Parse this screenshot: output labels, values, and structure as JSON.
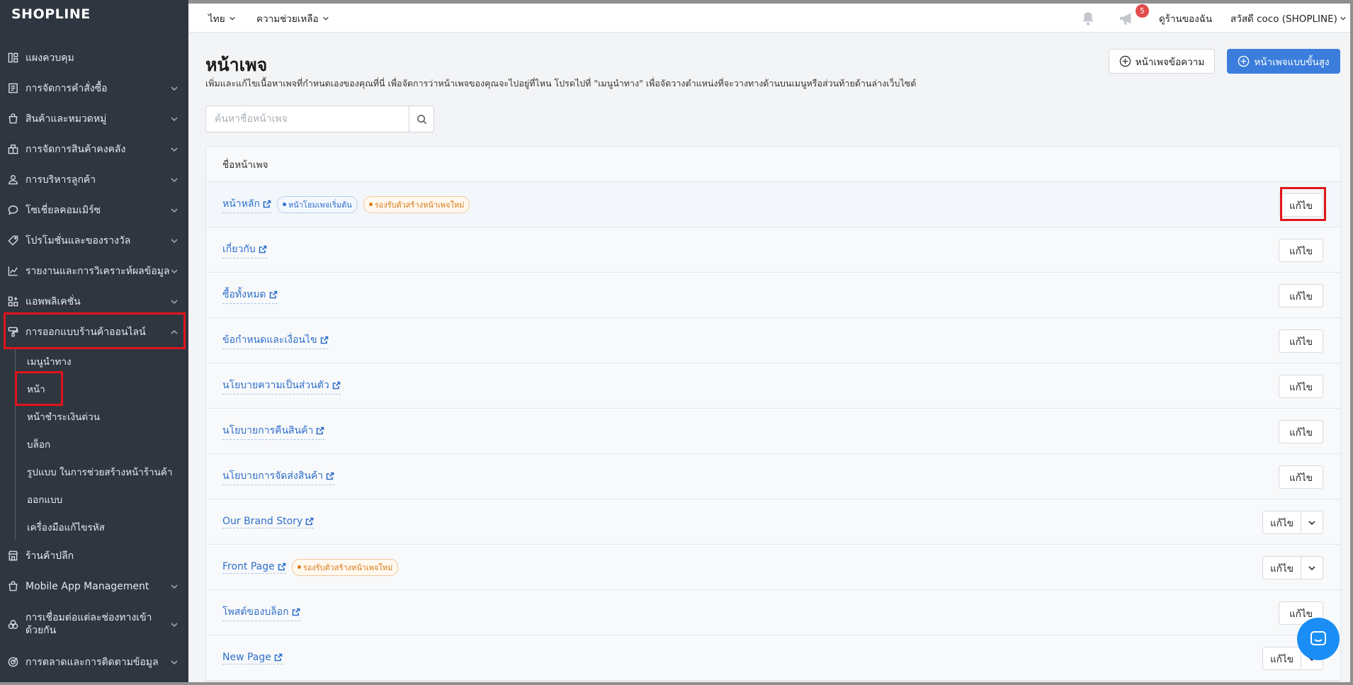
{
  "brand": {
    "logo": "SHOPLINE"
  },
  "topbar": {
    "language": "ไทย",
    "help": "ความช่วยเหลือ",
    "notification_count": "5",
    "view_store": "ดูร้านของฉัน",
    "greeting": "สวัสดี coco (SHOPLINE)"
  },
  "sidebar": {
    "items": [
      {
        "label": "แผงควบคุม",
        "icon": "dashboard-icon"
      },
      {
        "label": "การจัดการคำสั่งซื้อ",
        "icon": "order-icon"
      },
      {
        "label": "สินค้าและหมวดหมู่",
        "icon": "shopping-bag-icon"
      },
      {
        "label": "การจัดการสินค้าคงคลัง",
        "icon": "warehouse-icon"
      },
      {
        "label": "การบริหารลูกค้า",
        "icon": "user-icon"
      },
      {
        "label": "โซเชี่ยลคอมเมิร์ซ",
        "icon": "chat-icon"
      },
      {
        "label": "โปรโมชั่นและของรางวัล",
        "icon": "tag-icon"
      },
      {
        "label": "รายงานและการวิเคราะห์ผลข้อมูล",
        "icon": "chart-icon"
      },
      {
        "label": "แอพพลิเคชั่น",
        "icon": "apps-icon"
      },
      {
        "label": "การออกแบบร้านค้าออนไลน์",
        "icon": "brush-icon"
      }
    ],
    "subitems": [
      "เมนูนำทาง",
      "หน้า",
      "หน้าชำระเงินด่วน",
      "บล็อก",
      "รูปแบบ ในการช่วยสร้างหน้าร้านค้า",
      "ออกแบบ",
      "เครื่องมือแก้ไขรหัส"
    ],
    "after": [
      {
        "label": "ร้านค้าปลีก",
        "icon": "store-icon"
      },
      {
        "label": "Mobile App Management",
        "icon": "mobile-icon"
      },
      {
        "label": "การเชื่อมต่อแต่ละช่องทางเข้าด้วยกัน",
        "icon": "channels-icon"
      },
      {
        "label": "การตลาดและการติดตามข้อมูล",
        "icon": "target-icon"
      }
    ]
  },
  "page": {
    "title": "หน้าเพจ",
    "description": "เพิ่มและแก้ไขเนื้อหาเพจที่กำหนดเองของคุณที่นี่ เพื่อจัดการว่าหน้าเพจของคุณจะไปอยู่ที่ไหน โปรดไปที่ \"เมนูนำทาง\" เพื่อจัดวางตำแหน่งที่จะวางทางด้านบนเมนูหรือส่วนท้ายด้านล่างเว็บไซต์",
    "btn_text_page": "หน้าเพจข้อความ",
    "btn_advanced_page": "หน้าเพจแบบขั้นสูง",
    "search_placeholder": "ค้นหาชื่อหน้าเพจ",
    "column_name": "ชื่อหน้าเพจ",
    "edit_label": "แก้ไข"
  },
  "pages": [
    {
      "name": "หน้าหลัก",
      "tags": [
        "หน้าโฮมเพจเริ่มต้น",
        "รองรับตัวสร้างหน้าเพจใหม่"
      ]
    },
    {
      "name": "เกี่ยวกับ",
      "tags": []
    },
    {
      "name": "ซื้อทั้งหมด",
      "tags": []
    },
    {
      "name": "ข้อกำหนดและเงื่อนไข",
      "tags": []
    },
    {
      "name": "นโยบายความเป็นส่วนตัว",
      "tags": []
    },
    {
      "name": "นโยบายการคืนสินค้า",
      "tags": []
    },
    {
      "name": "นโยบายการจัดส่งสินค้า",
      "tags": []
    },
    {
      "name": "Our Brand Story",
      "tags": []
    },
    {
      "name": "Front Page",
      "tags": [
        "รองรับตัวสร้างหน้าเพจใหม่"
      ]
    },
    {
      "name": "โพสต์ของบล็อก",
      "tags": []
    },
    {
      "name": "New Page",
      "tags": []
    }
  ],
  "colors": {
    "accent": "#3b7ddd",
    "sidebar": "#2f3640",
    "highlight": "#e0141c"
  }
}
